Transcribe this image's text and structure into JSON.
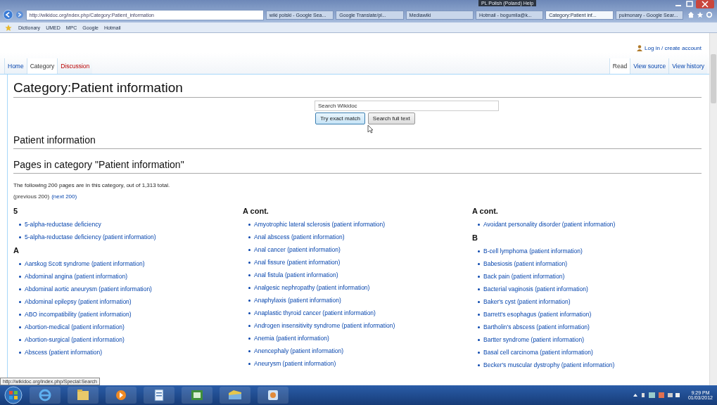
{
  "browser": {
    "language_bar": [
      "PL Polish (Poland)",
      "Help"
    ],
    "address": "http://wikidoc.org/index.php/Category:Patient_information",
    "tabs": [
      {
        "label": "wiki polski - Google Sea...",
        "selected": false
      },
      {
        "label": "Google Translate/pl...",
        "selected": false
      },
      {
        "label": "Mediawiki",
        "selected": false
      },
      {
        "label": "Hotmail - bogumila@k...",
        "selected": false
      },
      {
        "label": "Category:Patient inf...",
        "selected": true
      },
      {
        "label": "pulmonary - Google Sear...",
        "selected": false
      }
    ],
    "favorites": [
      "Dictionary",
      "UMED",
      "MPC",
      "Google",
      "Hotmail"
    ]
  },
  "page": {
    "user_links": "Log in / create account",
    "left_tabs": [
      {
        "label": "Home",
        "selected": false,
        "kind": "link"
      },
      {
        "label": "Category",
        "selected": true,
        "kind": "link"
      },
      {
        "label": "Discussion",
        "selected": false,
        "kind": "new"
      }
    ],
    "right_tabs": [
      {
        "label": "Read",
        "selected": true
      },
      {
        "label": "View source",
        "selected": false
      },
      {
        "label": "View history",
        "selected": false
      }
    ],
    "title": "Category:Patient information",
    "search": {
      "value": "Search Wikidoc"
    },
    "buttons": [
      "Try exact match",
      "Search full text"
    ],
    "sections": [
      "Patient information",
      "Pages in category \"Patient information\""
    ],
    "summary": "The following 200 pages are in this category, out of 1,313 total.",
    "nav": [
      {
        "label": "(previous 200)",
        "kind": "text"
      },
      {
        "label": "(next 200)",
        "kind": "link"
      }
    ],
    "columns": [
      {
        "groups": [
          {
            "heading": "5",
            "items": [
              "5-alpha-reductase deficiency",
              "5-alpha-reductase deficiency (patient information)"
            ]
          },
          {
            "heading": "A",
            "items": [
              "Aarskog Scott syndrome (patient information)",
              "Abdominal angina (patient information)",
              "Abdominal aortic aneurysm (patient information)",
              "Abdominal epilepsy (patient information)",
              "ABO incompatibility (patient information)",
              "Abortion-medical (patient information)",
              "Abortion-surgical (patient information)",
              "Abscess (patient information)"
            ]
          }
        ]
      },
      {
        "groups": [
          {
            "heading": "A cont.",
            "items": [
              "Amyotrophic lateral sclerosis (patient information)",
              "Anal abscess (patient information)",
              "Anal cancer (patient information)",
              "Anal fissure (patient information)",
              "Anal fistula (patient information)",
              "Analgesic nephropathy (patient information)",
              "Anaphylaxis (patient information)",
              "Anaplastic thyroid cancer (patient information)",
              "Androgen insensitivity syndrome (patient information)",
              "Anemia (patient information)",
              "Anencephaly (patient information)",
              "Aneurysm (patient information)"
            ]
          }
        ]
      },
      {
        "groups": [
          {
            "heading": "A cont.",
            "items": [
              "Avoidant personality disorder (patient information)"
            ]
          },
          {
            "heading": "B",
            "items": [
              "B-cell lymphoma (patient information)",
              "Babesiosis (patient information)",
              "Back pain (patient information)",
              "Bacterial vaginosis (patient information)",
              "Baker's cyst (patient information)",
              "Barrett's esophagus (patient information)",
              "Bartholin's abscess (patient information)",
              "Bartter syndrome (patient information)",
              "Basal cell carcinoma (patient information)",
              "Becker's muscular dystrophy (patient information)"
            ]
          }
        ]
      }
    ]
  },
  "status_url": "http://wikidoc.org/index.php/Special:Search",
  "taskbar": {
    "time": "9:29 PM",
    "date": "01/03/2012"
  }
}
